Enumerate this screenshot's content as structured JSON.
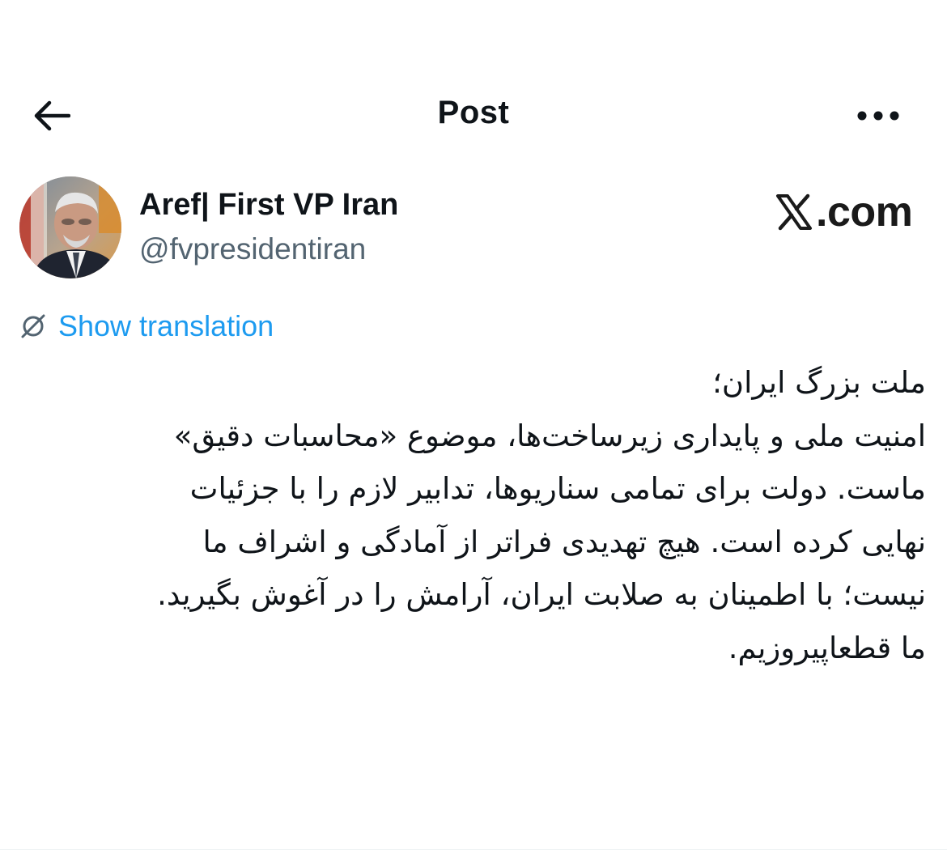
{
  "header": {
    "title": "Post",
    "back_icon": "arrow-left-icon",
    "more_icon": "ellipsis-icon"
  },
  "author": {
    "display_name": "Aref| First VP Iran",
    "handle": "@fvpresidentiran",
    "avatar_icon": "avatar-photo"
  },
  "watermark": {
    "text": ".com",
    "logo_icon": "x-logo-icon"
  },
  "translation": {
    "label": "Show translation",
    "icon": "globe-slash-icon"
  },
  "post": {
    "lines": [
      "ملت بزرگ ایران؛",
      "امنیت ملی و پایداری زیرساخت‌ها، موضوع «محاسبات دقیق»",
      "ماست. دولت برای تمامی سناریوها، تدابیر لازم را با جزئیات",
      "نهایی کرده است. هیچ تهدیدی فراتر از آمادگی و اشراف ما",
      "نیست؛ با اطمینان به صلابت ایران، آرامش را در آغوش بگیرید.",
      "ما قطعاپیروزیم."
    ]
  },
  "colors": {
    "text_primary": "#0f1419",
    "text_secondary": "#536471",
    "accent_blue": "#1d9bf0",
    "background": "#ffffff"
  }
}
